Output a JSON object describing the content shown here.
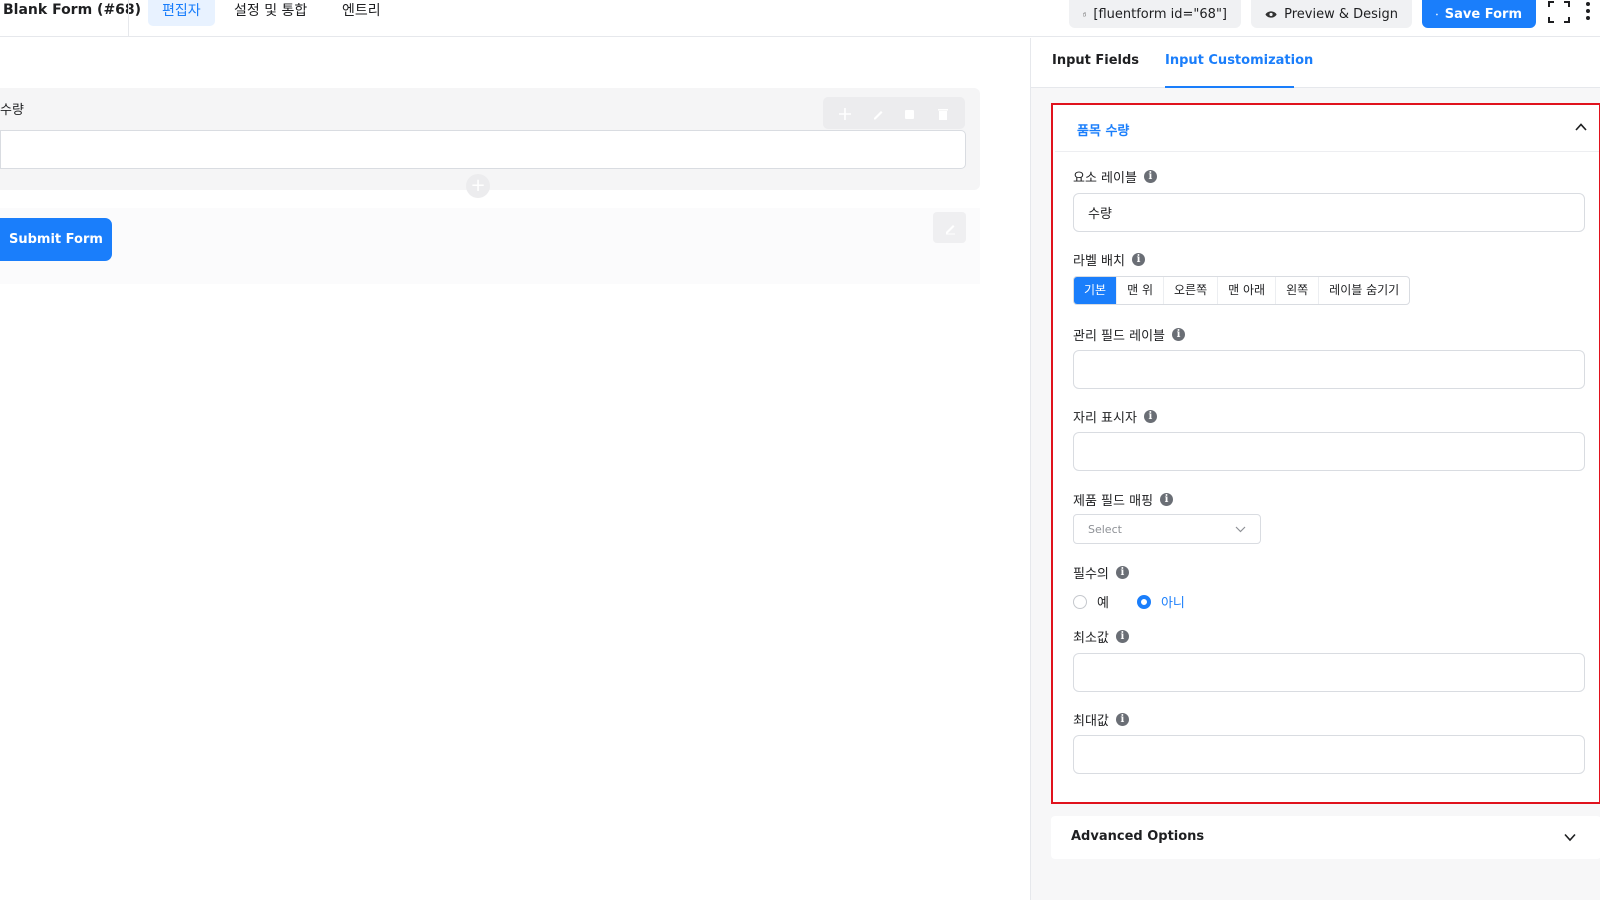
{
  "header": {
    "form_title": "Blank Form (#68)",
    "tabs": [
      {
        "label": "편집자",
        "active": true
      },
      {
        "label": "설정 및 통합",
        "active": false
      },
      {
        "label": "엔트리",
        "active": false
      }
    ],
    "shortcode_button": "[fluentform id=\"68\"]",
    "preview_button": "Preview & Design",
    "save_button": "Save Form"
  },
  "editor": {
    "field_label": "수량",
    "submit_label": "Submit Form"
  },
  "sidebar": {
    "tabs": [
      {
        "label": "Input Fields",
        "active": false
      },
      {
        "label": "Input Customization",
        "active": true
      }
    ],
    "section_title": "품목 수량",
    "element_label": {
      "label": "요소 레이블",
      "value": "수량"
    },
    "label_placement": {
      "label": "라벨 배치",
      "options": [
        "기본",
        "맨 위",
        "오른쪽",
        "맨 아래",
        "왼쪽",
        "레이블 숨기기"
      ],
      "selected": "기본"
    },
    "admin_field_label": {
      "label": "관리 필드 레이블",
      "value": ""
    },
    "placeholder": {
      "label": "자리 표시자",
      "value": ""
    },
    "product_field_mapping": {
      "label": "제품 필드 매핑",
      "selected": "Select"
    },
    "required": {
      "label": "필수의",
      "options": [
        "예",
        "아니"
      ],
      "selected": "아니"
    },
    "min_value": {
      "label": "최소값",
      "value": ""
    },
    "max_value": {
      "label": "최대값",
      "value": ""
    },
    "advanced_options": "Advanced Options"
  },
  "colors": {
    "accent": "#1a7efb",
    "highlight_border": "#e0121d"
  }
}
